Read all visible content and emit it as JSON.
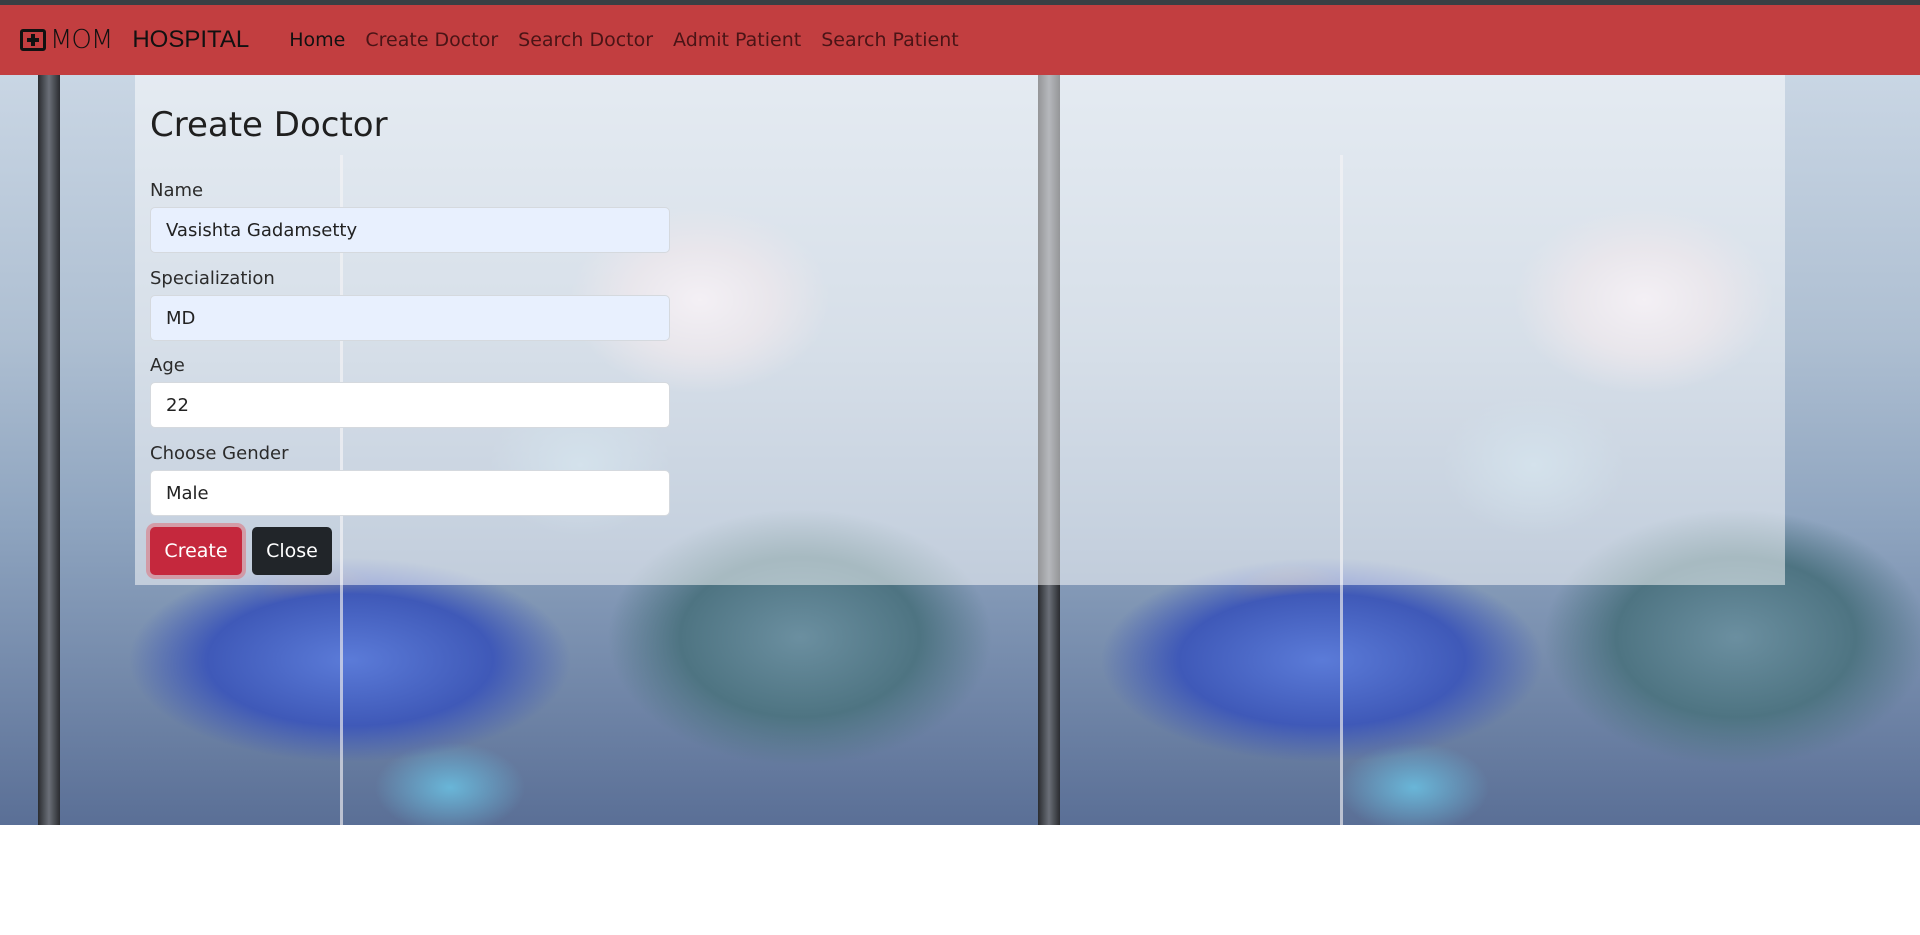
{
  "brand": {
    "logo_text": "MOM",
    "logo_icon": "medical-cross-icon",
    "name": "HOSPITAL"
  },
  "nav": {
    "items": [
      {
        "label": "Home",
        "active": true
      },
      {
        "label": "Create Doctor",
        "active": false
      },
      {
        "label": "Search Doctor",
        "active": false
      },
      {
        "label": "Admit Patient",
        "active": false
      },
      {
        "label": "Search Patient",
        "active": false
      }
    ]
  },
  "form": {
    "title": "Create Doctor",
    "fields": {
      "name": {
        "label": "Name",
        "value": "Vasishta Gadamsetty"
      },
      "specialization": {
        "label": "Specialization",
        "value": "MD"
      },
      "age": {
        "label": "Age",
        "value": "22"
      },
      "gender": {
        "label": "Choose Gender",
        "value": "Male"
      }
    },
    "buttons": {
      "create": "Create",
      "close": "Close"
    }
  },
  "colors": {
    "navbar": "#c23e40",
    "create_button": "#c5283d",
    "close_button": "#212529"
  }
}
